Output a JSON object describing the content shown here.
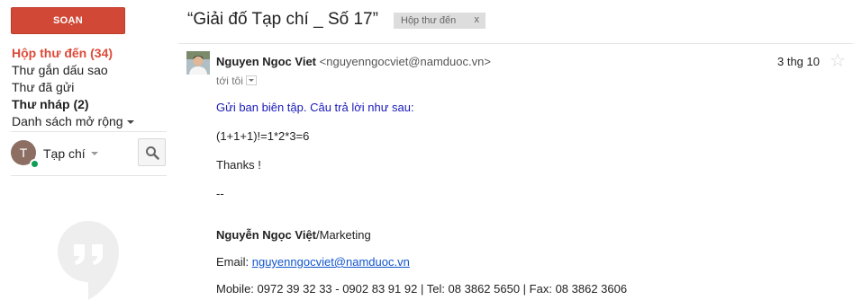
{
  "sidebar": {
    "compose_label": "SOẠN",
    "items": [
      {
        "label": "Hộp thư đến (34)"
      },
      {
        "label": "Thư gắn dấu sao"
      },
      {
        "label": "Thư đã gửi"
      },
      {
        "label": "Thư nháp (2)"
      },
      {
        "label": "Danh sách mở rộng"
      }
    ],
    "chat": {
      "avatar_letter": "T",
      "name": "Tạp chí"
    }
  },
  "thread": {
    "subject": "“Giải đố Tạp chí _ Số 17”",
    "label": "Hộp thư đến",
    "label_remove": "x"
  },
  "message": {
    "sender_name": "Nguyen Ngoc Viet",
    "sender_email": "<nguyenngocviet@namduoc.vn>",
    "date": "3 thg 10",
    "to": "tới tôi",
    "body": {
      "greeting": "Gửi ban biên tập. Câu trả lời như sau:",
      "answer": "(1+1+1)!=1*2*3=6",
      "thanks": "Thanks !",
      "sig_sep": "--",
      "sig_name": "Nguyễn Ngọc Việt",
      "sig_title": "/Marketing",
      "email_label": "Email: ",
      "email_value": "nguyenngocviet@namduoc.vn",
      "mobile": "Mobile: 0972 39 32 33 - 0902 83 91 92 | Tel: 08 3862 5650 | Fax: 08 3862 3606"
    }
  },
  "colors": {
    "compose": "#d14836",
    "active": "#dd4b39",
    "link": "#1155cc",
    "online": "#0f9d58"
  }
}
